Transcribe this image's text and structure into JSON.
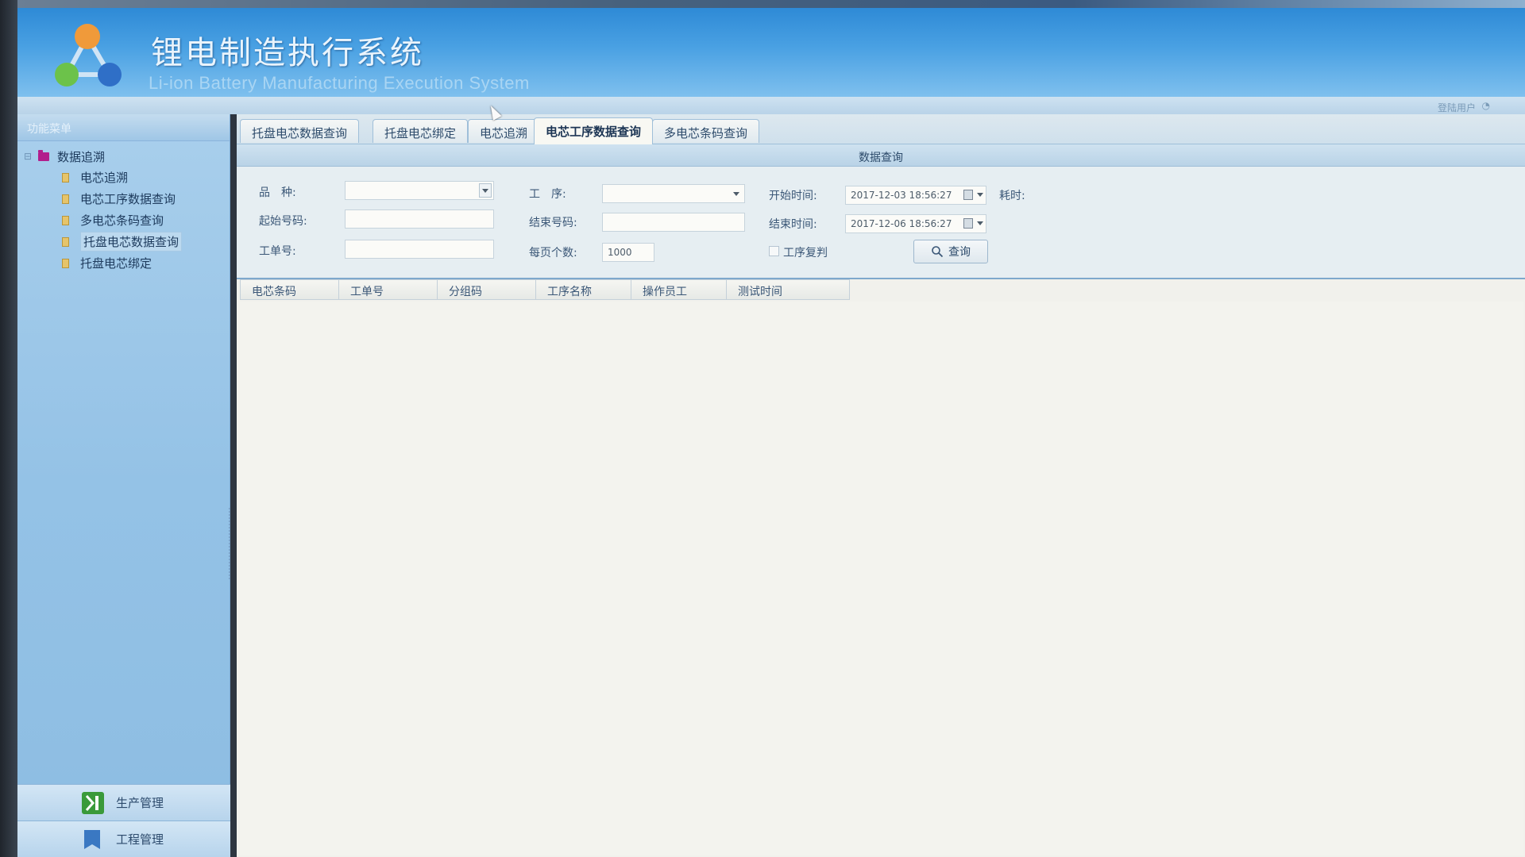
{
  "header": {
    "title_cn": "锂电制造执行系统",
    "title_en": "Li-ion Battery Manufacturing Execution System",
    "user_link": "登陆用户",
    "user_icon": "user-icon"
  },
  "sidebar": {
    "heading": "功能菜单",
    "root": {
      "label": "数据追溯",
      "icon": "folder-icon"
    },
    "items": [
      {
        "label": "电芯追溯",
        "icon": "document-icon"
      },
      {
        "label": "电芯工序数据查询",
        "icon": "document-icon"
      },
      {
        "label": "多电芯条码查询",
        "icon": "document-icon"
      },
      {
        "label": "托盘电芯数据查询",
        "icon": "document-icon",
        "selected": true
      },
      {
        "label": "托盘电芯绑定",
        "icon": "document-icon"
      }
    ],
    "accordions": [
      {
        "label": "生产管理",
        "icon": "production-icon",
        "color": "#3a9a3a"
      },
      {
        "label": "工程管理",
        "icon": "engineering-icon",
        "color": "#3a78c2"
      }
    ]
  },
  "tabs": [
    {
      "label": "托盘电芯数据查询"
    },
    {
      "label": "托盘电芯绑定"
    },
    {
      "label": "电芯追溯"
    },
    {
      "label": "电芯工序数据查询",
      "active": true
    },
    {
      "label": "多电芯条码查询"
    }
  ],
  "panel": {
    "title": "数据查询"
  },
  "form": {
    "variety": {
      "label": "品　种:",
      "value": ""
    },
    "process": {
      "label": "工　序:",
      "value": ""
    },
    "start_time": {
      "label": "开始时间:",
      "value": "2017-12-03 18:56:27"
    },
    "elapsed": {
      "label": "耗时:"
    },
    "start_code": {
      "label": "起始号码:",
      "value": ""
    },
    "end_code": {
      "label": "结束号码:",
      "value": ""
    },
    "end_time": {
      "label": "结束时间:",
      "value": "2017-12-06 18:56:27"
    },
    "work_order": {
      "label": "工单号:",
      "value": ""
    },
    "page_size": {
      "label": "每页个数:",
      "value": "1000"
    },
    "repeat": {
      "label": "工序复判",
      "checked": false
    },
    "query_button": {
      "label": "查询",
      "icon": "search-icon"
    }
  },
  "table": {
    "columns": [
      "电芯条码",
      "工单号",
      "分组码",
      "工序名称",
      "操作员工",
      "测试时间"
    ],
    "rows": []
  },
  "colors": {
    "header_blue": "#2e8ad6",
    "sidebar_blue": "#94c2e6",
    "accent_magenta": "#b21e8c"
  }
}
